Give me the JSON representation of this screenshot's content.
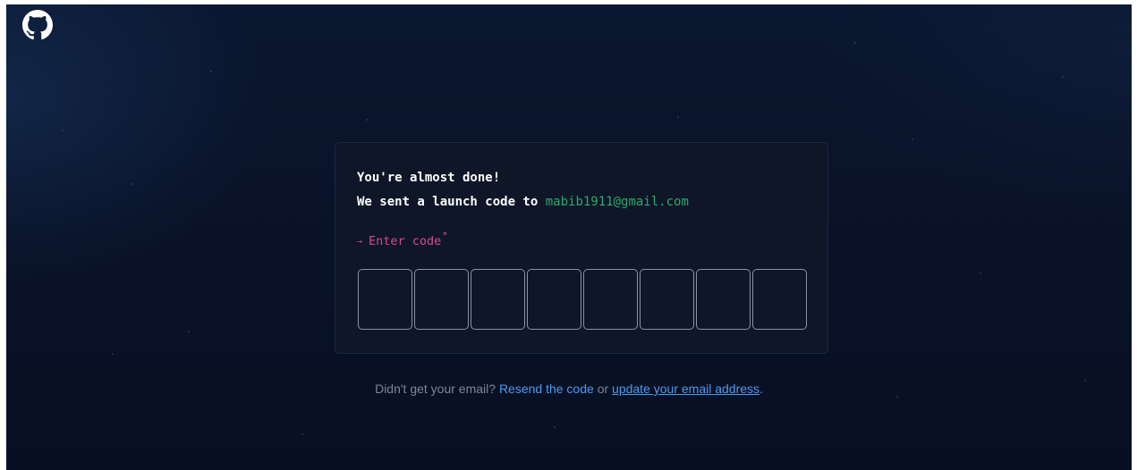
{
  "header": {
    "logo_icon": "github-octocat-icon"
  },
  "card": {
    "heading": "You're almost done!",
    "sent_prefix": "We sent a launch code to",
    "email": "mabib1911@gmail.com",
    "code_label": "Enter code",
    "code_label_arrow": "→",
    "required_marker": "*",
    "code_boxes": [
      "",
      "",
      "",
      "",
      "",
      "",
      "",
      ""
    ]
  },
  "footer": {
    "prefix": "Didn't get your email?",
    "resend_link": "Resend the code",
    "or_text": "or",
    "update_link": "update your email address",
    "suffix": "."
  },
  "colors": {
    "background": "#0a1329",
    "card_background": "#0e1628",
    "email": "#2ea96a",
    "label_accent": "#d8498f",
    "link": "#4f9aef",
    "muted_text": "#7d8596"
  }
}
